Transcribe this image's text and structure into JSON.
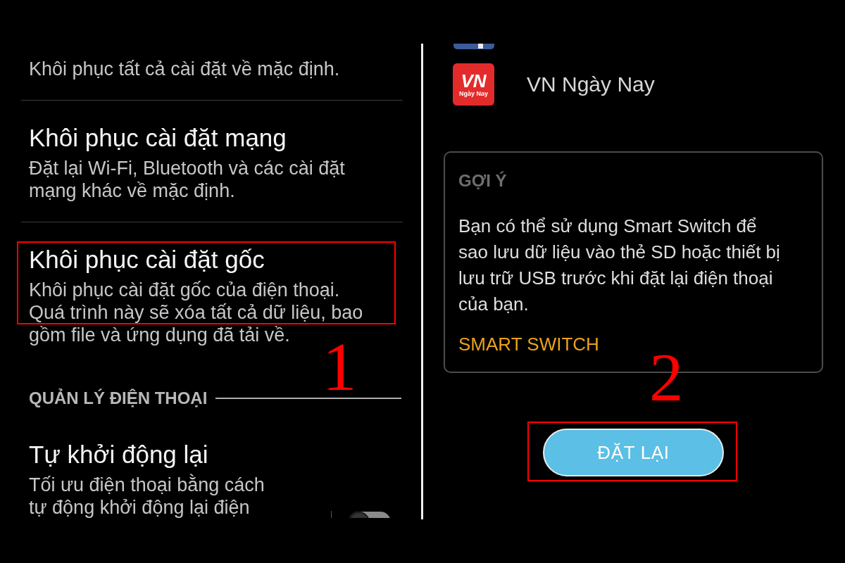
{
  "left_screen": {
    "items": [
      {
        "kind": "text",
        "description": "Khôi phục tất cả cài đặt về mặc định.",
        "highlighted": false
      },
      {
        "kind": "text",
        "title": "Khôi phục cài đặt mạng",
        "description": "Đặt lại Wi-Fi, Bluetooth và các cài đặt mạng khác về mặc định.",
        "highlighted": false
      },
      {
        "kind": "text",
        "title": "Khôi phục cài đặt gốc",
        "description": "Khôi phục cài đặt gốc của điện thoại. Quá trình này sẽ xóa tất cả dữ liệu, bao gồm file và ứng dụng đã tải về.",
        "highlighted": true
      }
    ],
    "step_number": "1",
    "section": {
      "title": "QUẢN LÝ ĐIỆN THOẠI",
      "items": [
        {
          "kind": "toggle",
          "title": "Tự khởi động lại",
          "description": "Tối ưu điện thoại bằng cách tự động khởi động lại điện",
          "on": false,
          "highlighted": false
        }
      ]
    }
  },
  "right_screen": {
    "apps": [
      {
        "kind": "partial"
      },
      {
        "kind": "full",
        "logo_text": "VN",
        "logo_caption": "Ngày Nay",
        "name": "VN Ngày Nay"
      }
    ],
    "hint_card": {
      "heading": "GỢI Ý",
      "text": "Bạn có thể sử dụng Smart Switch để sao lưu dữ liệu vào thẻ SD hoặc thiết bị lưu trữ USB trước khi đặt lại điện thoại của bạn.",
      "link": "SMART SWITCH"
    },
    "step_number": "2",
    "reset_button": {
      "label": "ĐẶT LẠI",
      "highlighted": true
    }
  }
}
